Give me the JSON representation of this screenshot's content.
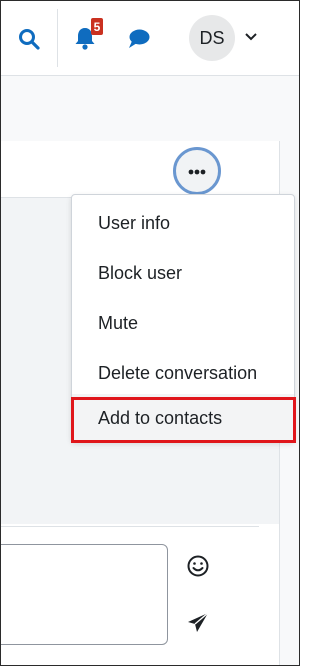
{
  "navbar": {
    "icons": {
      "search": "search-icon",
      "notifications": "bell-icon",
      "messages": "chat-bubble-icon",
      "user_caret": "chevron-down-icon"
    },
    "notification_count": "5",
    "avatar_initials": "DS"
  },
  "conversation": {
    "actions_icon": "ellipsis-icon",
    "emoji_icon": "smiley-icon",
    "send_icon": "paper-plane-icon"
  },
  "menu": {
    "items": [
      {
        "label": "User info"
      },
      {
        "label": "Block user"
      },
      {
        "label": "Mute"
      },
      {
        "label": "Delete conversation"
      },
      {
        "label": "Add to contacts"
      }
    ],
    "highlighted_index": 4
  },
  "colors": {
    "brand_blue": "#0f6cbf",
    "badge_red": "#ca3120",
    "highlight_red": "#e0161b",
    "focus_ring": "#6a97d0"
  }
}
